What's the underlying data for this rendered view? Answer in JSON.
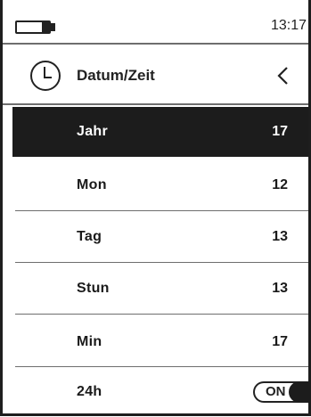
{
  "status": {
    "time": "13:17",
    "battery_icon": "battery-icon"
  },
  "header": {
    "icon": "clock-icon",
    "title": "Datum/Zeit",
    "back_icon": "chevron-left-icon"
  },
  "rows": [
    {
      "label": "Jahr",
      "value": "17"
    },
    {
      "label": "Mon",
      "value": "12"
    },
    {
      "label": "Tag",
      "value": "13"
    },
    {
      "label": "Stun",
      "value": "13"
    },
    {
      "label": "Min",
      "value": "17"
    },
    {
      "label": "24h",
      "value": "ON"
    }
  ],
  "selected_row": "Jahr",
  "colors": {
    "selected_bg": "#1c1c1c",
    "selected_fg": "#ffffff",
    "text": "#1a1a1a",
    "divider": "#6e6e6e"
  }
}
